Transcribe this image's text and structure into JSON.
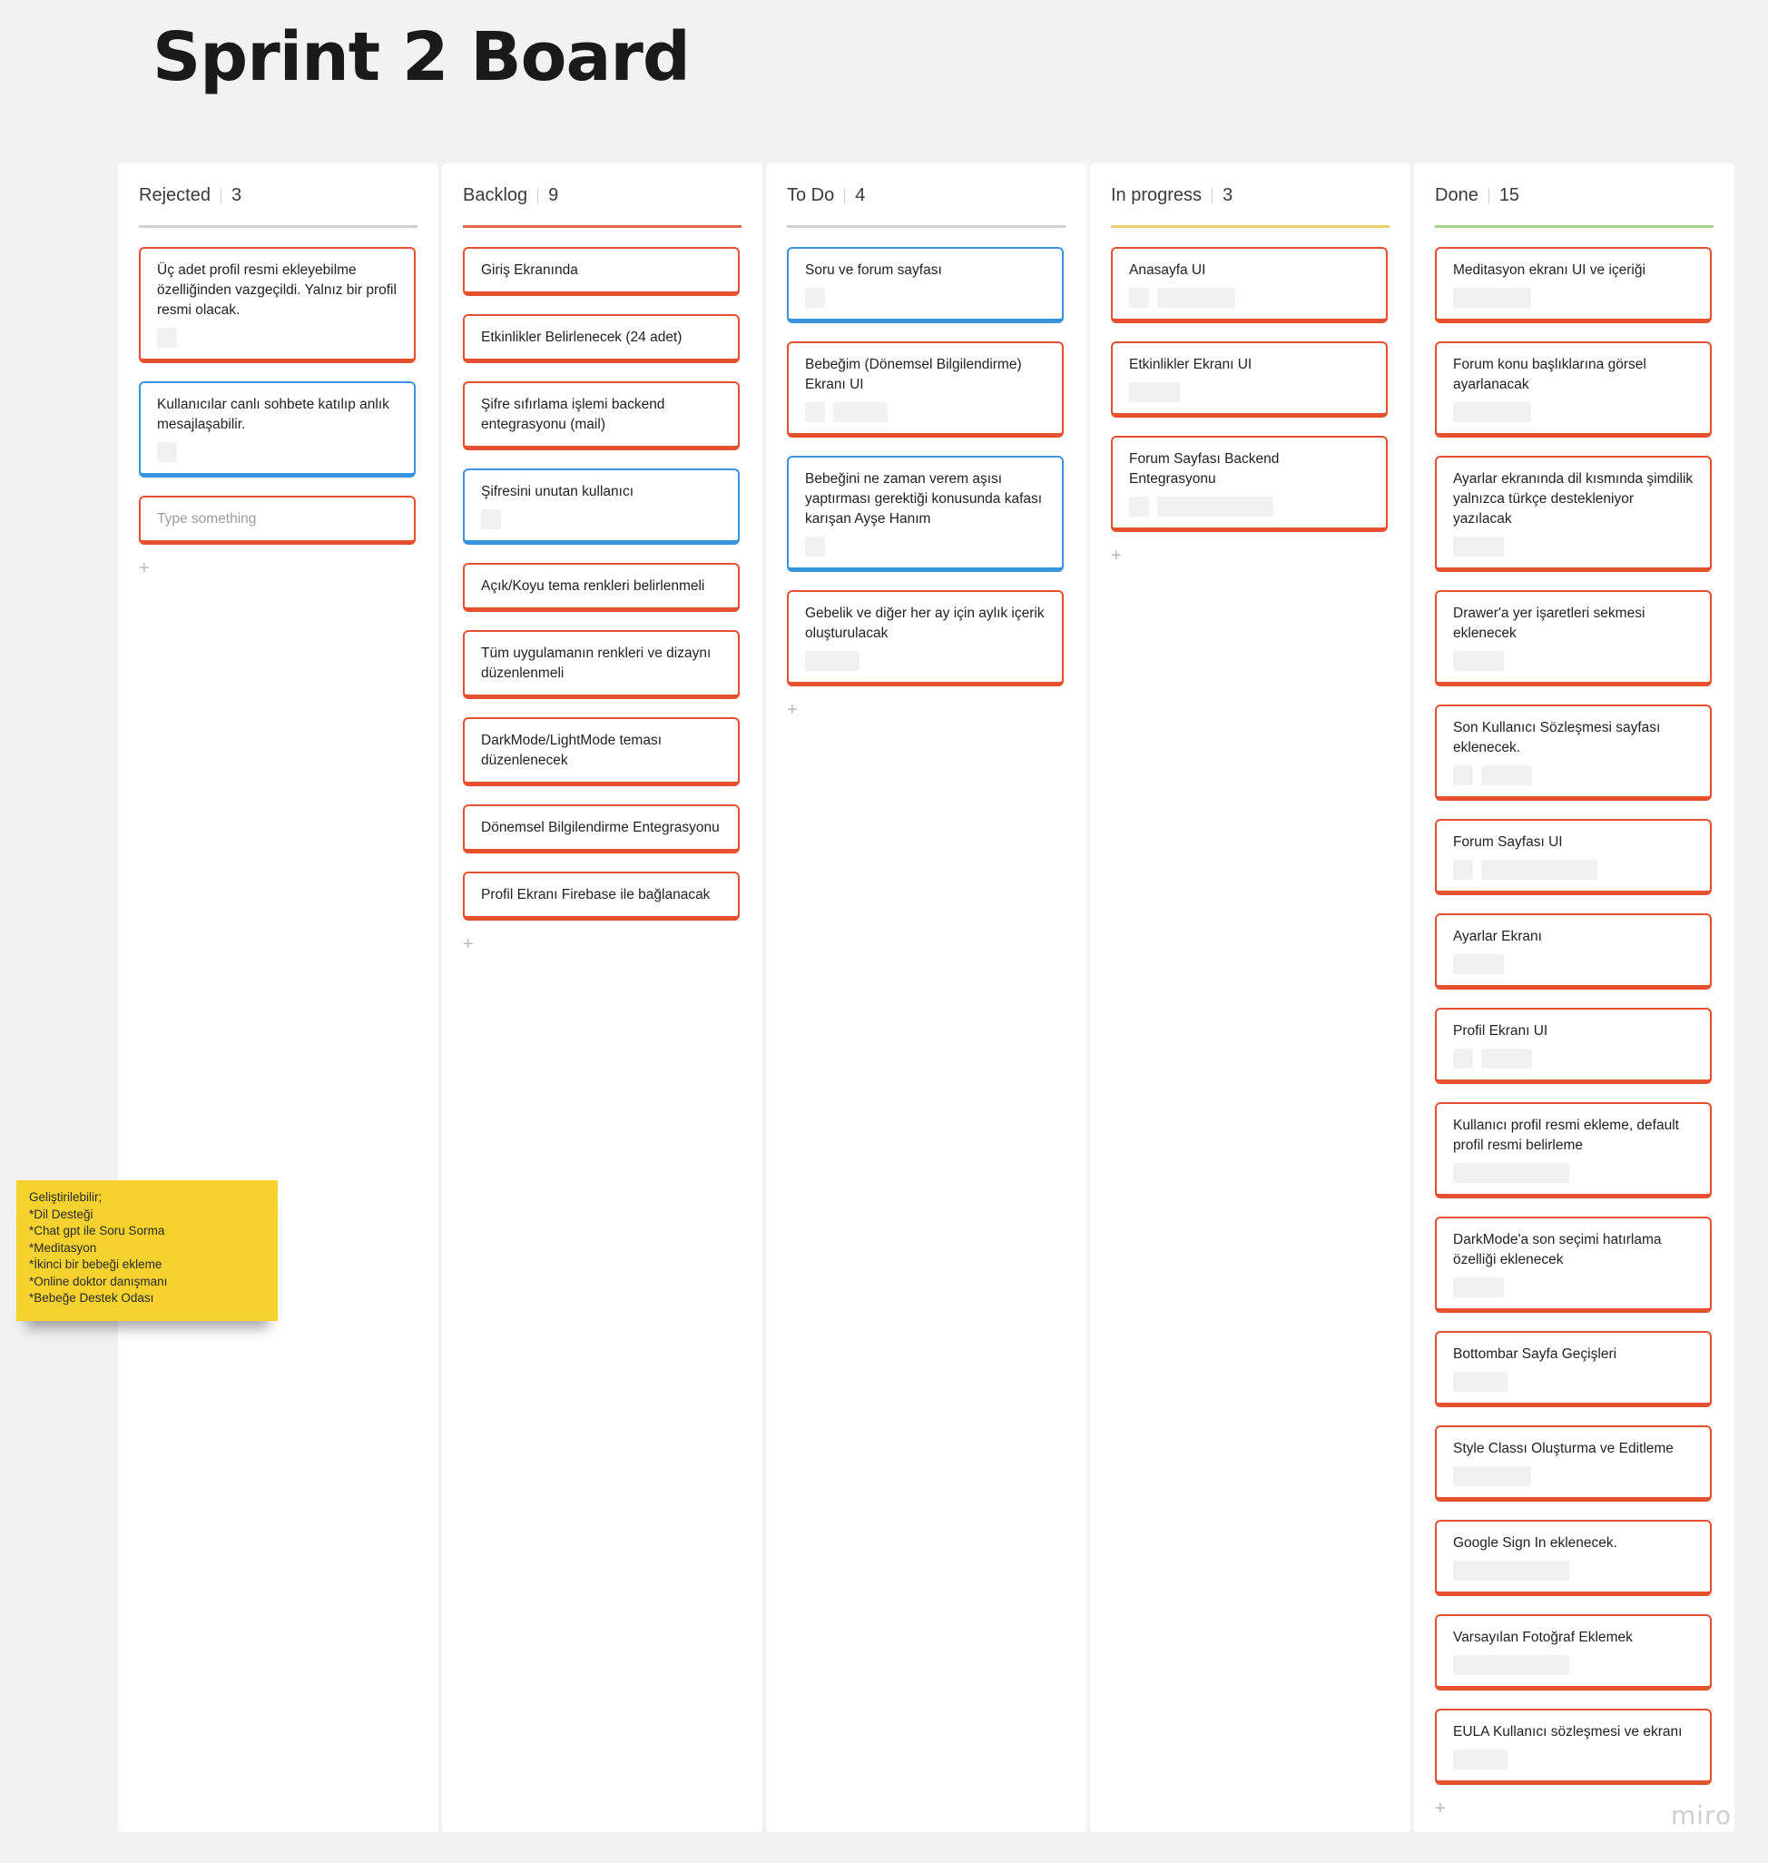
{
  "board": {
    "title": "Sprint 2 Board"
  },
  "columns": [
    {
      "name": "Rejected",
      "count": "3",
      "cards": [
        {
          "text": "Üç adet profil resmi ekleyebilme özelliğinden vazgeçildi. Yalnız bir profil resmi olacak.",
          "color": "red",
          "chips": [
            22
          ]
        },
        {
          "text": "Kullanıcılar canlı sohbete katılıp anlık mesajlaşabilir.",
          "color": "blue",
          "chips": [
            22
          ]
        },
        {
          "text": "Type something",
          "color": "red",
          "placeholder": true,
          "chips": []
        }
      ]
    },
    {
      "name": "Backlog",
      "count": "9",
      "cards": [
        {
          "text": "Giriş Ekranında",
          "color": "red",
          "chips": []
        },
        {
          "text": "Etkinlikler Belirlenecek (24 adet)",
          "color": "red",
          "chips": []
        },
        {
          "text": "Şifre sıfırlama işlemi backend entegrasyonu (mail)",
          "color": "red",
          "chips": []
        },
        {
          "text": "Şifresini unutan kullanıcı",
          "color": "blue",
          "chips": [
            22
          ]
        },
        {
          "text": "Açık/Koyu tema renkleri belirlenmeli",
          "color": "red",
          "chips": []
        },
        {
          "text": "Tüm uygulamanın renkleri ve dizaynı düzenlenmeli",
          "color": "red",
          "chips": []
        },
        {
          "text": "DarkMode/LightMode teması düzenlenecek",
          "color": "red",
          "chips": []
        },
        {
          "text": "Dönemsel Bilgilendirme Entegrasyonu",
          "color": "red",
          "chips": []
        },
        {
          "text": "Profil Ekranı Firebase ile bağlanacak",
          "color": "red",
          "chips": []
        }
      ]
    },
    {
      "name": "To Do",
      "count": "4",
      "cards": [
        {
          "text": "Soru ve forum sayfası",
          "color": "blue",
          "chips": [
            22
          ]
        },
        {
          "text": "Bebeğim (Dönemsel Bilgilendirme) Ekranı UI",
          "color": "red",
          "chips": [
            22,
            60
          ]
        },
        {
          "text": "Bebeğini ne zaman verem aşısı yaptırması gerektiği konusunda kafası karışan Ayşe Hanım",
          "color": "blue",
          "chips": [
            22
          ]
        },
        {
          "text": "Gebelik ve diğer her ay için aylık içerik oluşturulacak",
          "color": "red",
          "chips": [
            60
          ]
        }
      ]
    },
    {
      "name": "In progress",
      "count": "3",
      "cards": [
        {
          "text": "Anasayfa UI",
          "color": "red",
          "chips": [
            22,
            86
          ]
        },
        {
          "text": "Etkinlikler Ekranı UI",
          "color": "red",
          "chips": [
            56
          ]
        },
        {
          "text": "Forum Sayfası Backend Entegrasyonu",
          "color": "red",
          "chips": [
            22,
            128
          ]
        }
      ]
    },
    {
      "name": "Done",
      "count": "15",
      "cards": [
        {
          "text": "Meditasyon ekranı UI ve içeriği",
          "color": "red",
          "chips": [
            86
          ]
        },
        {
          "text": "Forum konu başlıklarına görsel ayarlanacak",
          "color": "red",
          "chips": [
            86
          ]
        },
        {
          "text": "Ayarlar ekranında dil kısmında şimdilik yalnızca türkçe destekleniyor yazılacak",
          "color": "red",
          "chips": [
            56
          ]
        },
        {
          "text": "Drawer'a yer işaretleri sekmesi eklenecek",
          "color": "red",
          "chips": [
            56
          ]
        },
        {
          "text": "Son Kullanıcı Sözleşmesi sayfası eklenecek.",
          "color": "red",
          "chips": [
            22,
            56
          ]
        },
        {
          "text": "Forum Sayfası UI",
          "color": "red",
          "chips": [
            22,
            128
          ]
        },
        {
          "text": "Ayarlar Ekranı",
          "color": "red",
          "chips": [
            56
          ]
        },
        {
          "text": "Profil Ekranı UI",
          "color": "red",
          "chips": [
            22,
            56
          ]
        },
        {
          "text": "Kullanıcı profil resmi ekleme, default profil resmi belirleme",
          "color": "red",
          "chips": [
            128
          ]
        },
        {
          "text": "DarkMode'a son seçimi hatırlama özelliği eklenecek",
          "color": "red",
          "chips": [
            56
          ]
        },
        {
          "text": "Bottombar Sayfa Geçişleri",
          "color": "red",
          "chips": [
            60
          ]
        },
        {
          "text": "Style Classı Oluşturma ve Editleme",
          "color": "red",
          "chips": [
            86
          ]
        },
        {
          "text": "Google Sign In eklenecek.",
          "color": "red",
          "chips": [
            128
          ]
        },
        {
          "text": "Varsayılan Fotoğraf Eklemek",
          "color": "red",
          "chips": [
            128
          ]
        },
        {
          "text": "EULA Kullanıcı sözleşmesi ve ekranı",
          "color": "red",
          "chips": [
            60
          ]
        }
      ]
    }
  ],
  "add_label": "+",
  "sticky": {
    "lines": [
      "Geliştirilebilir;",
      "*Dil Desteği",
      "*Chat gpt ile Soru Sorma",
      "*Meditasyon",
      "*İkinci bir bebeği ekleme",
      "*Online doktor danışmanı",
      "*Bebeğe Destek Odası"
    ]
  },
  "watermark": "miro",
  "colors": {
    "card_red": "#e6502f",
    "card_blue": "#3a93dd",
    "sticky": "#f5d22e"
  }
}
